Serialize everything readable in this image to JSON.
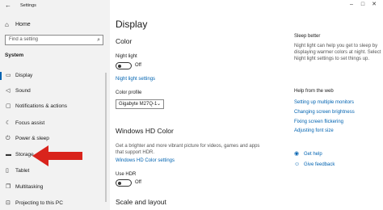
{
  "window": {
    "title": "Settings"
  },
  "sidebar": {
    "home_label": "Home",
    "search_placeholder": "Find a setting",
    "section": "System",
    "items": [
      {
        "label": "Display",
        "icon": "monitor-icon"
      },
      {
        "label": "Sound",
        "icon": "speaker-icon"
      },
      {
        "label": "Notifications & actions",
        "icon": "message-icon"
      },
      {
        "label": "Focus assist",
        "icon": "moon-icon"
      },
      {
        "label": "Power & sleep",
        "icon": "power-icon"
      },
      {
        "label": "Storage",
        "icon": "drive-icon"
      },
      {
        "label": "Tablet",
        "icon": "tablet-icon"
      },
      {
        "label": "Multitasking",
        "icon": "multitask-icon"
      },
      {
        "label": "Projecting to this PC",
        "icon": "project-icon"
      }
    ]
  },
  "main": {
    "title": "Display",
    "color_heading": "Color",
    "night_light_label": "Night light",
    "night_light_state": "Off",
    "night_light_settings": "Night light settings",
    "color_profile_label": "Color profile",
    "color_profile_value": "Gigabyte M27Q-1",
    "hd_color_heading": "Windows HD Color",
    "hd_color_desc": "Get a brighter and more vibrant picture for videos, games and apps that support HDR.",
    "hd_color_settings": "Windows HD Color settings",
    "use_hdr_label": "Use HDR",
    "use_hdr_state": "Off",
    "scale_heading": "Scale and layout"
  },
  "right": {
    "sleep_heading": "Sleep better",
    "sleep_text": "Night light can help you get to sleep by displaying warmer colors at night. Select Night light settings to set things up.",
    "help_heading": "Help from the web",
    "links": [
      "Setting up multiple monitors",
      "Changing screen brightness",
      "Fixing screen flickering",
      "Adjusting font size"
    ],
    "get_help": "Get help",
    "give_feedback": "Give feedback"
  },
  "colors": {
    "accent": "#0063b1",
    "arrow": "#d9241c",
    "sidebar_bg": "#f2f2f2"
  }
}
